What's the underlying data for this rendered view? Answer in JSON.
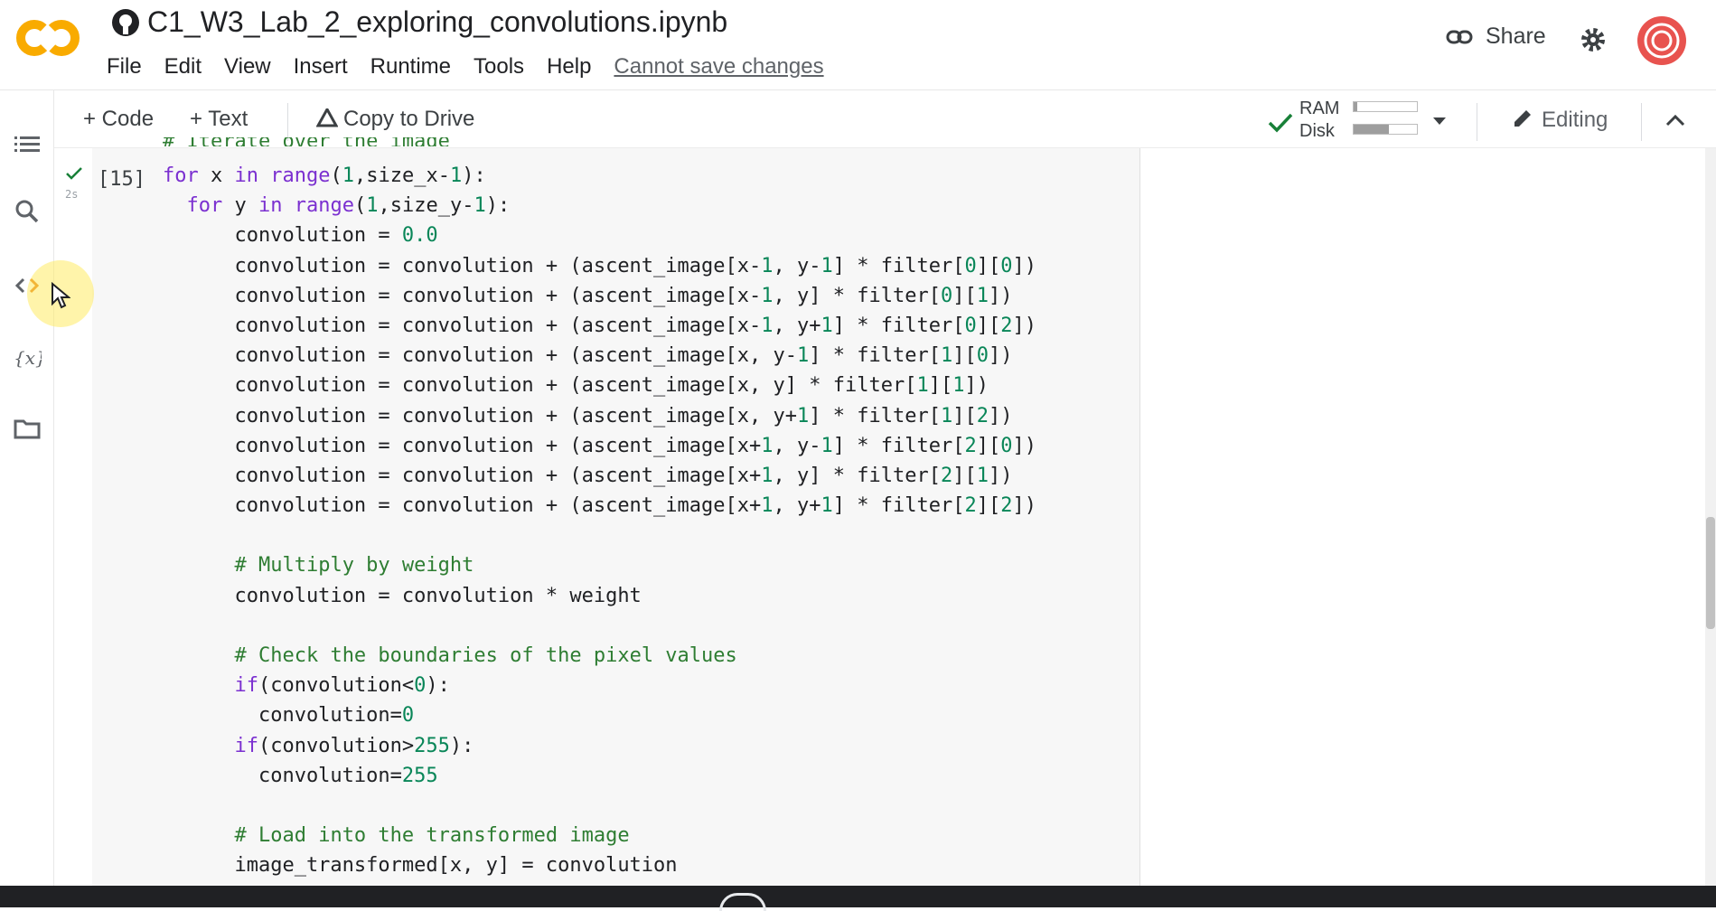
{
  "header": {
    "title": "C1_W3_Lab_2_exploring_convolutions.ipynb",
    "menu": [
      "File",
      "Edit",
      "View",
      "Insert",
      "Runtime",
      "Tools",
      "Help"
    ],
    "save_status": "Cannot save changes",
    "share_label": "Share"
  },
  "toolbar": {
    "add_code": "+ Code",
    "add_text": "+ Text",
    "copy_to_drive": "Copy to Drive",
    "ram_label": "RAM",
    "disk_label": "Disk",
    "ram_usage": 0.05,
    "disk_usage": 0.55,
    "editing_label": "Editing"
  },
  "sidebar": {
    "icons": [
      "table-of-contents-icon",
      "search-icon",
      "code-snippets-icon",
      "variables-icon",
      "files-icon"
    ]
  },
  "cell": {
    "exec_count": "[15]",
    "run_time": "2s",
    "partial_top_line": "# Iterate over the image",
    "lines": [
      "for x in range(1,size_x-1):",
      "  for y in range(1,size_y-1):",
      "      convolution = 0.0",
      "      convolution = convolution + (ascent_image[x-1, y-1] * filter[0][0])",
      "      convolution = convolution + (ascent_image[x-1, y] * filter[0][1])",
      "      convolution = convolution + (ascent_image[x-1, y+1] * filter[0][2])",
      "      convolution = convolution + (ascent_image[x, y-1] * filter[1][0])",
      "      convolution = convolution + (ascent_image[x, y] * filter[1][1])",
      "      convolution = convolution + (ascent_image[x, y+1] * filter[1][2])",
      "      convolution = convolution + (ascent_image[x+1, y-1] * filter[2][0])",
      "      convolution = convolution + (ascent_image[x+1, y] * filter[2][1])",
      "      convolution = convolution + (ascent_image[x+1, y+1] * filter[2][2])",
      "",
      "      # Multiply by weight",
      "      convolution = convolution * weight",
      "",
      "      # Check the boundaries of the pixel values",
      "      if(convolution<0):",
      "        convolution=0",
      "      if(convolution>255):",
      "        convolution=255",
      "",
      "      # Load into the transformed image",
      "      image_transformed[x, y] = convolution"
    ]
  },
  "colors": {
    "keyword": "#7b30d0",
    "number": "#098658",
    "comment": "#2e7d32",
    "logo_orange": "#f9ab00",
    "avatar": "#e8534f"
  }
}
